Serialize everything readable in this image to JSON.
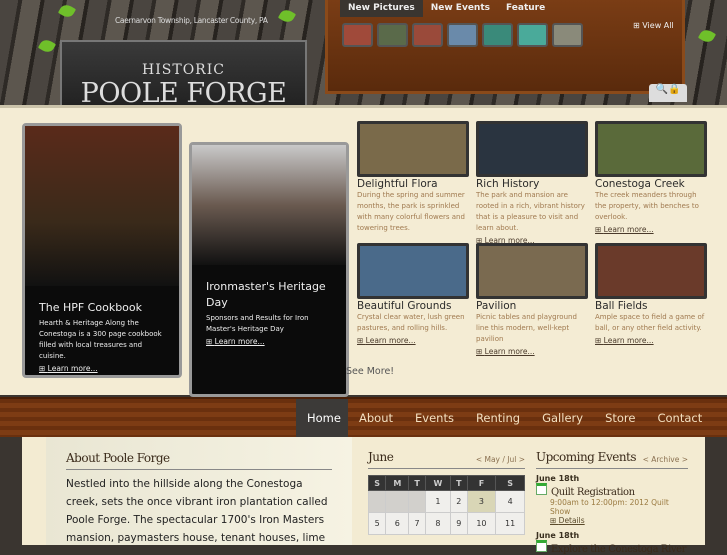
{
  "header": {
    "tagline": "Caernarvon Township, Lancaster County, PA",
    "logo_top": "HISTORIC",
    "logo_main": "POOLE FORGE"
  },
  "media_tabs": [
    {
      "label": "New Pictures",
      "icon": "pictures-icon"
    },
    {
      "label": "New Events",
      "icon": "calendar-icon"
    },
    {
      "label": "Feature",
      "icon": "gear-icon"
    }
  ],
  "view_all": "View All",
  "featured": [
    {
      "title": "The HPF Cookbook",
      "text": "Hearth & Heritage Along the Conestoga is a 300 page cookbook filled with local treasures and cuisine.",
      "link": "Learn more..."
    },
    {
      "title": "Ironmaster's Heritage Day",
      "text": "Sponsors and Results for Iron Master's Heritage Day",
      "link": "Learn more..."
    }
  ],
  "cards": [
    {
      "title": "Delightful Flora",
      "text": "During the spring and summer months, the park is sprinkled with many colorful flowers and towering trees.",
      "color": "#7a6a4a"
    },
    {
      "title": "Rich History",
      "text": "The park and mansion are rooted in a rich, vibrant history that is a pleasure to visit and learn about.",
      "link": "Learn more...",
      "color": "#2a3440"
    },
    {
      "title": "Conestoga Creek",
      "text": "The creek meanders through the property, with benches to overlook.",
      "link": "Learn more...",
      "color": "#5a6a3a"
    },
    {
      "title": "Beautiful Grounds",
      "text": "Crystal clear water, lush green pastures, and rolling hills.",
      "link": "Learn more...",
      "color": "#4a6a8a"
    },
    {
      "title": "Pavilion",
      "text": "Picnic tables and playground line this modern, well-kept pavilion",
      "link": "Learn more...",
      "color": "#7a6a50"
    },
    {
      "title": "Ball Fields",
      "text": "Ample space to field a game of ball, or any other field activity.",
      "link": "Learn more...",
      "color": "#6a3a2a"
    }
  ],
  "see_more": "See More!",
  "nav": [
    "Home",
    "About",
    "Events",
    "Renting",
    "Gallery",
    "Store",
    "Contact"
  ],
  "about": {
    "title": "About Poole Forge",
    "text": "Nestled into the hillside along the Conestoga creek, sets the once vibrant iron plantation called Poole Forge. The spectacular 1700's Iron Masters mansion, paymasters house, tenant houses, lime"
  },
  "calendar": {
    "month": "June",
    "nav": "< May / Jul >",
    "days": [
      "S",
      "M",
      "T",
      "W",
      "T",
      "F",
      "S"
    ],
    "week1": [
      "",
      "",
      "",
      "1",
      "2",
      "3",
      "4"
    ],
    "week2": [
      "5",
      "6",
      "7",
      "8",
      "9",
      "10",
      "11"
    ],
    "today": "3"
  },
  "events": {
    "title": "Upcoming Events",
    "nav": "< Archive >",
    "items": [
      {
        "date": "June 18th",
        "name": "Quilt Registration",
        "info": "9:00am to 12:00pm: 2012 Quilt Show",
        "link": "Details"
      },
      {
        "date": "June 18th",
        "name": "Explore the Conestoga River"
      }
    ]
  }
}
